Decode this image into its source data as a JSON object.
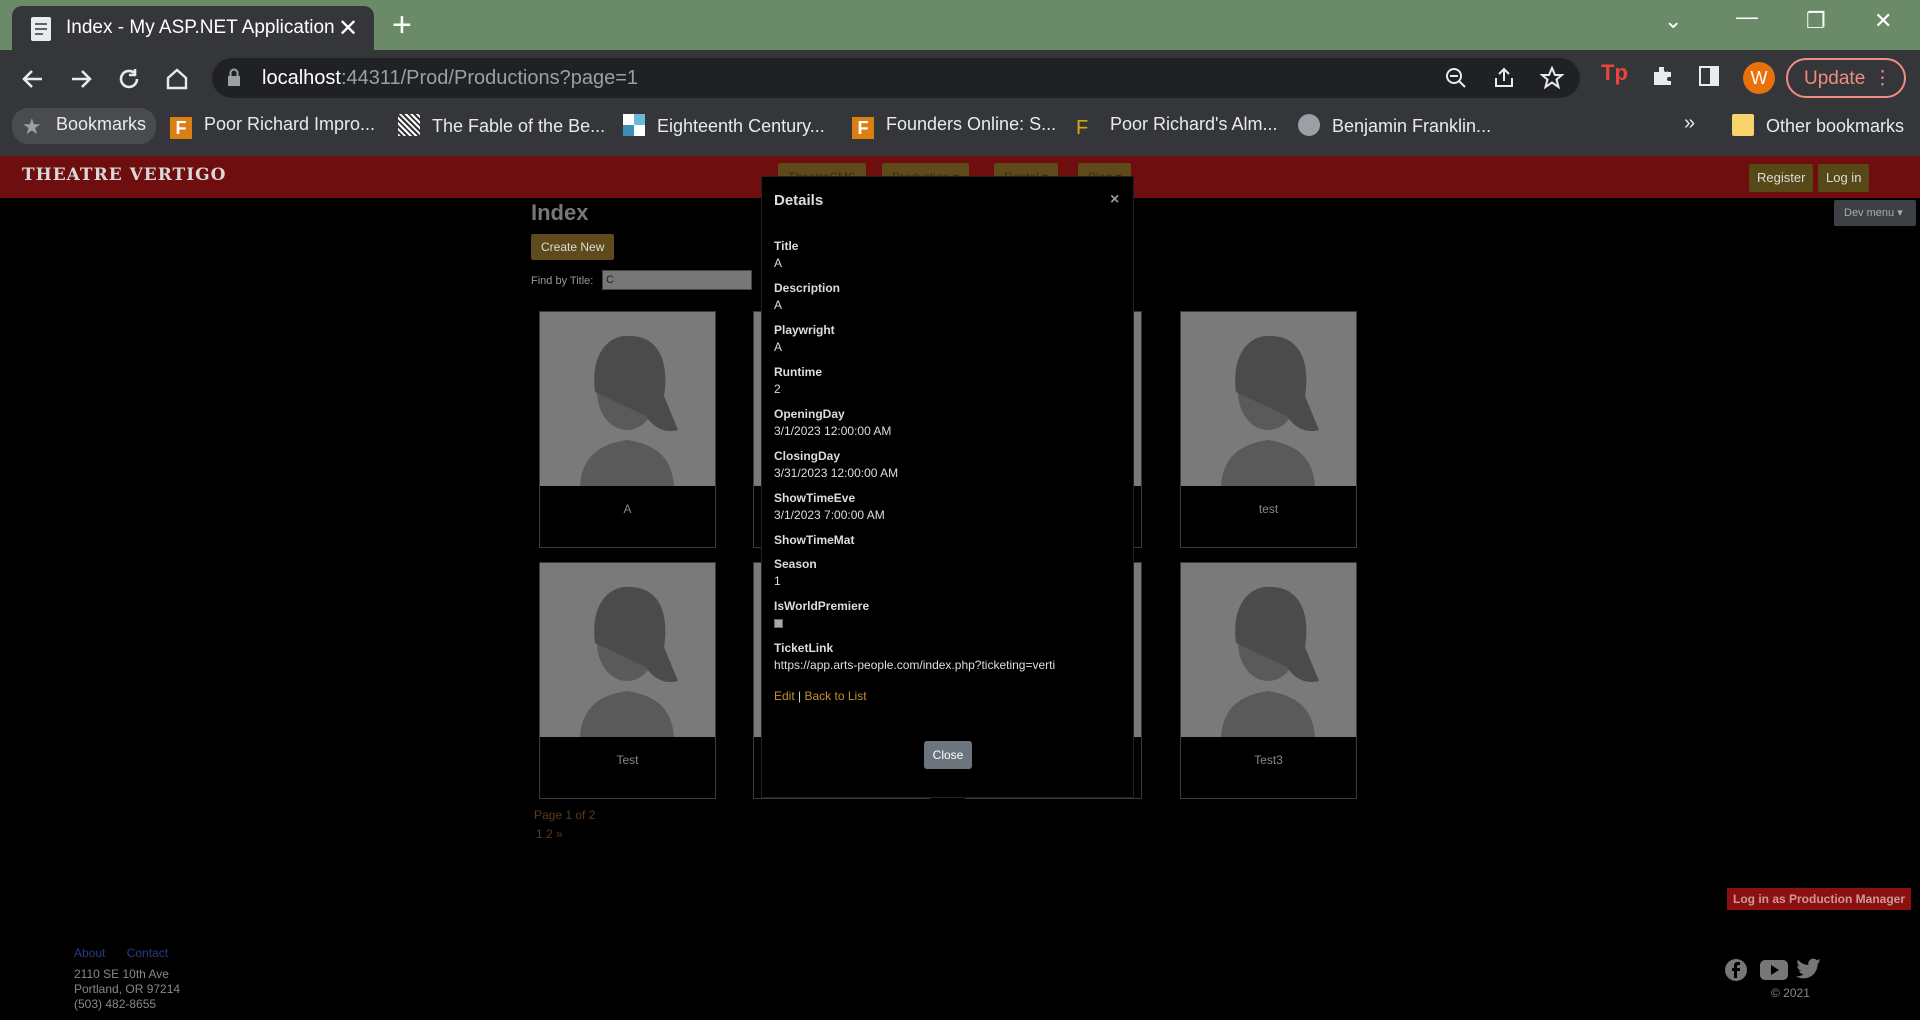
{
  "browser": {
    "tab_title": "Index - My ASP.NET Application",
    "url_host": "localhost",
    "url_rest": ":44311/Prod/Productions?page=1",
    "update_label": "Update",
    "avatar_letter": "W",
    "bookmarks": [
      {
        "label": "Bookmarks",
        "icon": "star-icon"
      },
      {
        "label": "Poor Richard Impro...",
        "icon": "founders-f-icon"
      },
      {
        "label": "The Fable of the Be...",
        "icon": "hatched-icon"
      },
      {
        "label": "Eighteenth Century...",
        "icon": "mosaic-icon"
      },
      {
        "label": "Founders Online: S...",
        "icon": "founders-f-icon"
      },
      {
        "label": "Poor Richard's Alm...",
        "icon": "letter-f-icon"
      },
      {
        "label": "Benjamin Franklin...",
        "icon": "globe-icon"
      }
    ],
    "more_bookmarks": "»",
    "other_bookmarks": "Other bookmarks"
  },
  "site": {
    "logo": "THEATRE VERTIGO",
    "nav": [
      "TheatreCMS",
      "Production ▾",
      "Rental ▾",
      "Blog ▾"
    ],
    "register": "Register",
    "login": "Log in",
    "dev_menu": "Dev menu ▾",
    "page_title": "Index",
    "create_new": "Create New",
    "find_label": "Find by Title:",
    "find_value": "C",
    "cards": [
      {
        "name": "A"
      },
      {
        "name": ""
      },
      {
        "name": ""
      },
      {
        "name": "test"
      },
      {
        "name": "Test"
      },
      {
        "name": ""
      },
      {
        "name": ""
      },
      {
        "name": "Test3"
      }
    ],
    "page_info": "Page 1 of 2",
    "page_links": "1 2 »",
    "pm_login": "Log in as Production Manager",
    "footer": {
      "about": "About",
      "contact": "Contact",
      "addr1": "2110 SE 10th Ave",
      "addr2": "Portland, OR 97214",
      "phone": "(503) 482-8655",
      "copyright": "© 2021"
    }
  },
  "modal": {
    "title": "Details",
    "close_x": "×",
    "fields": [
      {
        "label": "Title",
        "value": "A"
      },
      {
        "label": "Description",
        "value": "A"
      },
      {
        "label": "Playwright",
        "value": "A"
      },
      {
        "label": "Runtime",
        "value": "2"
      },
      {
        "label": "OpeningDay",
        "value": "3/1/2023 12:00:00 AM"
      },
      {
        "label": "ClosingDay",
        "value": "3/31/2023 12:00:00 AM"
      },
      {
        "label": "ShowTimeEve",
        "value": "3/1/2023 7:00:00 AM"
      },
      {
        "label": "ShowTimeMat",
        "value": ""
      },
      {
        "label": "Season",
        "value": "1"
      },
      {
        "label": "IsWorldPremiere",
        "value": ""
      },
      {
        "label": "TicketLink",
        "value": "https://app.arts-people.com/index.php?ticketing=verti"
      }
    ],
    "edit": "Edit",
    "sep": "|",
    "back": "Back to List",
    "close_button": "Close"
  }
}
